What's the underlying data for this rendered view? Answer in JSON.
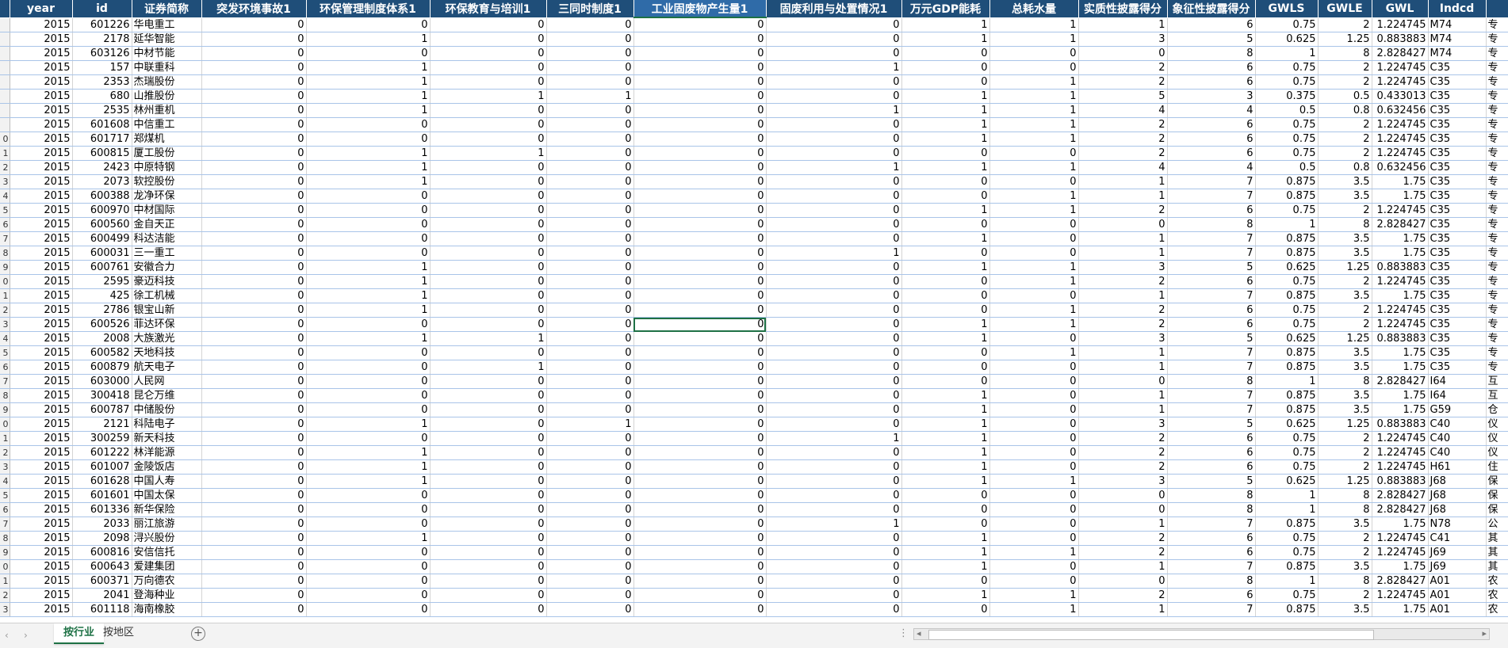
{
  "columns": [
    {
      "label": "",
      "w": 12,
      "align": "rn"
    },
    {
      "label": "year",
      "w": 79,
      "align": "n"
    },
    {
      "label": "id",
      "w": 75,
      "align": "n"
    },
    {
      "label": "证券简称",
      "w": 88,
      "align": "t"
    },
    {
      "label": "突发环境事故1",
      "w": 132,
      "align": "n"
    },
    {
      "label": "环保管理制度体系1",
      "w": 156,
      "align": "n"
    },
    {
      "label": "环保教育与培训1",
      "w": 147,
      "align": "n"
    },
    {
      "label": "三同时制度1",
      "w": 110,
      "align": "n"
    },
    {
      "label": "工业固废物产生量1",
      "w": 167,
      "align": "n"
    },
    {
      "label": "固废利用与处置情况1",
      "w": 171,
      "align": "n"
    },
    {
      "label": "万元GDP能耗",
      "w": 111,
      "align": "n"
    },
    {
      "label": "总耗水量",
      "w": 112,
      "align": "n"
    },
    {
      "label": "实质性披露得分",
      "w": 112,
      "align": "n"
    },
    {
      "label": "象征性披露得分",
      "w": 111,
      "align": "n"
    },
    {
      "label": "GWLS",
      "w": 79,
      "align": "n"
    },
    {
      "label": "GWLE",
      "w": 68,
      "align": "n"
    },
    {
      "label": "GWL",
      "w": 71,
      "align": "n"
    },
    {
      "label": "Indcd",
      "w": 73,
      "align": "t"
    },
    {
      "label": "",
      "w": 38,
      "align": "t"
    }
  ],
  "active_header": 8,
  "active_cell": {
    "row": 21,
    "col": 8
  },
  "rows": [
    [
      "",
      "2015",
      "601226",
      "华电重工",
      "0",
      "0",
      "0",
      "0",
      "0",
      "0",
      "1",
      "1",
      "1",
      "6",
      "0.75",
      "2",
      "1.224745",
      "M74",
      "专"
    ],
    [
      "",
      "2015",
      "2178",
      "延华智能",
      "0",
      "1",
      "0",
      "0",
      "0",
      "0",
      "1",
      "1",
      "3",
      "5",
      "0.625",
      "1.25",
      "0.883883",
      "M74",
      "专"
    ],
    [
      "",
      "2015",
      "603126",
      "中材节能",
      "0",
      "0",
      "0",
      "0",
      "0",
      "0",
      "0",
      "0",
      "0",
      "8",
      "1",
      "8",
      "2.828427",
      "M74",
      "专"
    ],
    [
      "",
      "2015",
      "157",
      "中联重科",
      "0",
      "1",
      "0",
      "0",
      "0",
      "1",
      "0",
      "0",
      "2",
      "6",
      "0.75",
      "2",
      "1.224745",
      "C35",
      "专"
    ],
    [
      "",
      "2015",
      "2353",
      "杰瑞股份",
      "0",
      "1",
      "0",
      "0",
      "0",
      "0",
      "0",
      "1",
      "2",
      "6",
      "0.75",
      "2",
      "1.224745",
      "C35",
      "专"
    ],
    [
      "",
      "2015",
      "680",
      "山推股份",
      "0",
      "1",
      "1",
      "1",
      "0",
      "0",
      "1",
      "1",
      "5",
      "3",
      "0.375",
      "0.5",
      "0.433013",
      "C35",
      "专"
    ],
    [
      "",
      "2015",
      "2535",
      "林州重机",
      "0",
      "1",
      "0",
      "0",
      "0",
      "1",
      "1",
      "1",
      "4",
      "4",
      "0.5",
      "0.8",
      "0.632456",
      "C35",
      "专"
    ],
    [
      "",
      "2015",
      "601608",
      "中信重工",
      "0",
      "0",
      "0",
      "0",
      "0",
      "0",
      "1",
      "1",
      "2",
      "6",
      "0.75",
      "2",
      "1.224745",
      "C35",
      "专"
    ],
    [
      "0",
      "2015",
      "601717",
      "郑煤机",
      "0",
      "0",
      "0",
      "0",
      "0",
      "0",
      "1",
      "1",
      "2",
      "6",
      "0.75",
      "2",
      "1.224745",
      "C35",
      "专"
    ],
    [
      "1",
      "2015",
      "600815",
      "厦工股份",
      "0",
      "1",
      "1",
      "0",
      "0",
      "0",
      "0",
      "0",
      "2",
      "6",
      "0.75",
      "2",
      "1.224745",
      "C35",
      "专"
    ],
    [
      "2",
      "2015",
      "2423",
      "中原特钢",
      "0",
      "1",
      "0",
      "0",
      "0",
      "1",
      "1",
      "1",
      "4",
      "4",
      "0.5",
      "0.8",
      "0.632456",
      "C35",
      "专"
    ],
    [
      "3",
      "2015",
      "2073",
      "软控股份",
      "0",
      "1",
      "0",
      "0",
      "0",
      "0",
      "0",
      "0",
      "1",
      "7",
      "0.875",
      "3.5",
      "1.75",
      "C35",
      "专"
    ],
    [
      "4",
      "2015",
      "600388",
      "龙净环保",
      "0",
      "0",
      "0",
      "0",
      "0",
      "0",
      "0",
      "1",
      "1",
      "7",
      "0.875",
      "3.5",
      "1.75",
      "C35",
      "专"
    ],
    [
      "5",
      "2015",
      "600970",
      "中材国际",
      "0",
      "0",
      "0",
      "0",
      "0",
      "0",
      "1",
      "1",
      "2",
      "6",
      "0.75",
      "2",
      "1.224745",
      "C35",
      "专"
    ],
    [
      "6",
      "2015",
      "600560",
      "金自天正",
      "0",
      "0",
      "0",
      "0",
      "0",
      "0",
      "0",
      "0",
      "0",
      "8",
      "1",
      "8",
      "2.828427",
      "C35",
      "专"
    ],
    [
      "7",
      "2015",
      "600499",
      "科达洁能",
      "0",
      "0",
      "0",
      "0",
      "0",
      "0",
      "1",
      "0",
      "1",
      "7",
      "0.875",
      "3.5",
      "1.75",
      "C35",
      "专"
    ],
    [
      "8",
      "2015",
      "600031",
      "三一重工",
      "0",
      "0",
      "0",
      "0",
      "0",
      "1",
      "0",
      "0",
      "1",
      "7",
      "0.875",
      "3.5",
      "1.75",
      "C35",
      "专"
    ],
    [
      "9",
      "2015",
      "600761",
      "安徽合力",
      "0",
      "1",
      "0",
      "0",
      "0",
      "0",
      "1",
      "1",
      "3",
      "5",
      "0.625",
      "1.25",
      "0.883883",
      "C35",
      "专"
    ],
    [
      "0",
      "2015",
      "2595",
      "豪迈科技",
      "0",
      "1",
      "0",
      "0",
      "0",
      "0",
      "0",
      "1",
      "2",
      "6",
      "0.75",
      "2",
      "1.224745",
      "C35",
      "专"
    ],
    [
      "1",
      "2015",
      "425",
      "徐工机械",
      "0",
      "1",
      "0",
      "0",
      "0",
      "0",
      "0",
      "0",
      "1",
      "7",
      "0.875",
      "3.5",
      "1.75",
      "C35",
      "专"
    ],
    [
      "2",
      "2015",
      "2786",
      "银宝山新",
      "0",
      "1",
      "0",
      "0",
      "0",
      "0",
      "0",
      "1",
      "2",
      "6",
      "0.75",
      "2",
      "1.224745",
      "C35",
      "专"
    ],
    [
      "3",
      "2015",
      "600526",
      "菲达环保",
      "0",
      "0",
      "0",
      "0",
      "0",
      "0",
      "1",
      "1",
      "2",
      "6",
      "0.75",
      "2",
      "1.224745",
      "C35",
      "专"
    ],
    [
      "4",
      "2015",
      "2008",
      "大族激光",
      "0",
      "1",
      "1",
      "0",
      "0",
      "0",
      "1",
      "0",
      "3",
      "5",
      "0.625",
      "1.25",
      "0.883883",
      "C35",
      "专"
    ],
    [
      "5",
      "2015",
      "600582",
      "天地科技",
      "0",
      "0",
      "0",
      "0",
      "0",
      "0",
      "0",
      "1",
      "1",
      "7",
      "0.875",
      "3.5",
      "1.75",
      "C35",
      "专"
    ],
    [
      "6",
      "2015",
      "600879",
      "航天电子",
      "0",
      "0",
      "1",
      "0",
      "0",
      "0",
      "0",
      "0",
      "1",
      "7",
      "0.875",
      "3.5",
      "1.75",
      "C35",
      "专"
    ],
    [
      "7",
      "2015",
      "603000",
      "人民网",
      "0",
      "0",
      "0",
      "0",
      "0",
      "0",
      "0",
      "0",
      "0",
      "8",
      "1",
      "8",
      "2.828427",
      "I64",
      "互"
    ],
    [
      "8",
      "2015",
      "300418",
      "昆仑万维",
      "0",
      "0",
      "0",
      "0",
      "0",
      "0",
      "1",
      "0",
      "1",
      "7",
      "0.875",
      "3.5",
      "1.75",
      "I64",
      "互"
    ],
    [
      "9",
      "2015",
      "600787",
      "中储股份",
      "0",
      "0",
      "0",
      "0",
      "0",
      "0",
      "1",
      "0",
      "1",
      "7",
      "0.875",
      "3.5",
      "1.75",
      "G59",
      "仓"
    ],
    [
      "0",
      "2015",
      "2121",
      "科陆电子",
      "0",
      "1",
      "0",
      "1",
      "0",
      "0",
      "1",
      "0",
      "3",
      "5",
      "0.625",
      "1.25",
      "0.883883",
      "C40",
      "仪"
    ],
    [
      "1",
      "2015",
      "300259",
      "新天科技",
      "0",
      "0",
      "0",
      "0",
      "0",
      "1",
      "1",
      "0",
      "2",
      "6",
      "0.75",
      "2",
      "1.224745",
      "C40",
      "仪"
    ],
    [
      "2",
      "2015",
      "601222",
      "林洋能源",
      "0",
      "1",
      "0",
      "0",
      "0",
      "0",
      "1",
      "0",
      "2",
      "6",
      "0.75",
      "2",
      "1.224745",
      "C40",
      "仪"
    ],
    [
      "3",
      "2015",
      "601007",
      "金陵饭店",
      "0",
      "1",
      "0",
      "0",
      "0",
      "0",
      "1",
      "0",
      "2",
      "6",
      "0.75",
      "2",
      "1.224745",
      "H61",
      "住"
    ],
    [
      "4",
      "2015",
      "601628",
      "中国人寿",
      "0",
      "1",
      "0",
      "0",
      "0",
      "0",
      "1",
      "1",
      "3",
      "5",
      "0.625",
      "1.25",
      "0.883883",
      "J68",
      "保"
    ],
    [
      "5",
      "2015",
      "601601",
      "中国太保",
      "0",
      "0",
      "0",
      "0",
      "0",
      "0",
      "0",
      "0",
      "0",
      "8",
      "1",
      "8",
      "2.828427",
      "J68",
      "保"
    ],
    [
      "6",
      "2015",
      "601336",
      "新华保险",
      "0",
      "0",
      "0",
      "0",
      "0",
      "0",
      "0",
      "0",
      "0",
      "8",
      "1",
      "8",
      "2.828427",
      "J68",
      "保"
    ],
    [
      "7",
      "2015",
      "2033",
      "丽江旅游",
      "0",
      "0",
      "0",
      "0",
      "0",
      "1",
      "0",
      "0",
      "1",
      "7",
      "0.875",
      "3.5",
      "1.75",
      "N78",
      "公"
    ],
    [
      "8",
      "2015",
      "2098",
      "浔兴股份",
      "0",
      "1",
      "0",
      "0",
      "0",
      "0",
      "1",
      "0",
      "2",
      "6",
      "0.75",
      "2",
      "1.224745",
      "C41",
      "其"
    ],
    [
      "9",
      "2015",
      "600816",
      "安信信托",
      "0",
      "0",
      "0",
      "0",
      "0",
      "0",
      "1",
      "1",
      "2",
      "6",
      "0.75",
      "2",
      "1.224745",
      "J69",
      "其"
    ],
    [
      "0",
      "2015",
      "600643",
      "爱建集团",
      "0",
      "0",
      "0",
      "0",
      "0",
      "0",
      "1",
      "0",
      "1",
      "7",
      "0.875",
      "3.5",
      "1.75",
      "J69",
      "其"
    ],
    [
      "1",
      "2015",
      "600371",
      "万向德农",
      "0",
      "0",
      "0",
      "0",
      "0",
      "0",
      "0",
      "0",
      "0",
      "8",
      "1",
      "8",
      "2.828427",
      "A01",
      "农"
    ],
    [
      "2",
      "2015",
      "2041",
      "登海种业",
      "0",
      "0",
      "0",
      "0",
      "0",
      "0",
      "1",
      "1",
      "2",
      "6",
      "0.75",
      "2",
      "1.224745",
      "A01",
      "农"
    ],
    [
      "3",
      "2015",
      "601118",
      "海南橡胶",
      "0",
      "0",
      "0",
      "0",
      "0",
      "0",
      "0",
      "1",
      "1",
      "7",
      "0.875",
      "3.5",
      "1.75",
      "A01",
      "农"
    ]
  ],
  "sheet_tabs": [
    {
      "label": "按行业",
      "active": true
    },
    {
      "label": "按地区",
      "active": false
    }
  ],
  "icons": {
    "prev": "‹",
    "next": "›",
    "add": "+",
    "dots": "⋮",
    "scroll_left": "◂",
    "scroll_right": "▸"
  }
}
